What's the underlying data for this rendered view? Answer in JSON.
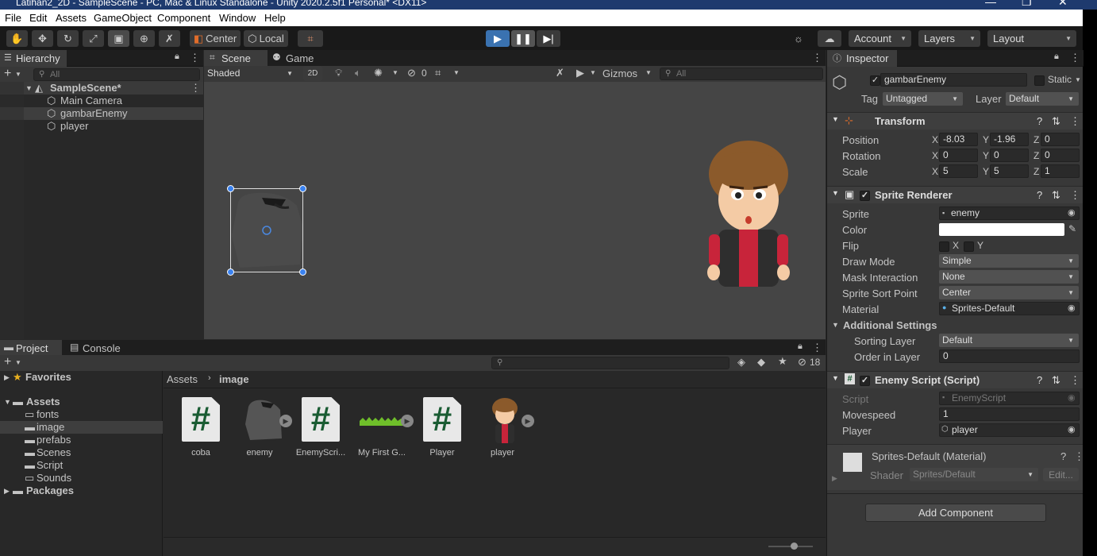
{
  "window": {
    "title": "Latihan2_2D - SampleScene - PC, Mac & Linux Standalone - Unity 2020.2.5f1 Personal* <DX11>"
  },
  "menu": [
    "File",
    "Edit",
    "Assets",
    "GameObject",
    "Component",
    "Window",
    "Help"
  ],
  "toolbar": {
    "pivot": "Center",
    "space": "Local",
    "account": "Account",
    "layers": "Layers",
    "layout": "Layout"
  },
  "hierarchy": {
    "tab": "Hierarchy",
    "search_placeholder": "All",
    "scene": "SampleScene*",
    "objects": [
      "Main Camera",
      "gambarEnemy",
      "player"
    ]
  },
  "scene_view": {
    "tabs": [
      "Scene",
      "Game"
    ],
    "shading": "Shaded",
    "mode2d": "2D",
    "hidden_count": "0",
    "gizmos": "Gizmos",
    "search_placeholder": "All"
  },
  "project": {
    "tabs": [
      "Project",
      "Console"
    ],
    "hidden_count": "18",
    "tree": {
      "favorites": "Favorites",
      "assets": "Assets",
      "folders": [
        "fonts",
        "image",
        "prefabs",
        "Scenes",
        "Script",
        "Sounds"
      ],
      "packages": "Packages"
    },
    "breadcrumb": [
      "Assets",
      "image"
    ],
    "assets": [
      {
        "name": "coba",
        "kind": "script"
      },
      {
        "name": "enemy",
        "kind": "sprite"
      },
      {
        "name": "EnemyScri...",
        "kind": "script"
      },
      {
        "name": "My First G...",
        "kind": "grass"
      },
      {
        "name": "Player",
        "kind": "script"
      },
      {
        "name": "player",
        "kind": "character"
      }
    ]
  },
  "inspector": {
    "tab": "Inspector",
    "object_name": "gambarEnemy",
    "static_label": "Static",
    "tag_label": "Tag",
    "tag_value": "Untagged",
    "layer_label": "Layer",
    "layer_value": "Default",
    "transform": {
      "title": "Transform",
      "position_label": "Position",
      "rotation_label": "Rotation",
      "scale_label": "Scale",
      "position": {
        "x": "-8.03",
        "y": "-1.96",
        "z": "0"
      },
      "rotation": {
        "x": "0",
        "y": "0",
        "z": "0"
      },
      "scale": {
        "x": "5",
        "y": "5",
        "z": "1"
      }
    },
    "sprite_renderer": {
      "title": "Sprite Renderer",
      "sprite_label": "Sprite",
      "sprite": "enemy",
      "color_label": "Color",
      "color": "#ffffff",
      "flip_label": "Flip",
      "flip_x": "X",
      "flip_y": "Y",
      "draw_mode_label": "Draw Mode",
      "draw_mode": "Simple",
      "mask_label": "Mask Interaction",
      "mask": "None",
      "sort_point_label": "Sprite Sort Point",
      "sort_point": "Center",
      "material_label": "Material",
      "material": "Sprites-Default",
      "additional": "Additional Settings",
      "sorting_layer_label": "Sorting Layer",
      "sorting_layer": "Default",
      "order_label": "Order in Layer",
      "order": "0"
    },
    "enemy_script": {
      "title": "Enemy Script (Script)",
      "script_label": "Script",
      "script": "EnemyScript",
      "movespeed_label": "Movespeed",
      "movespeed": "1",
      "player_label": "Player",
      "player": "player"
    },
    "material": {
      "title": "Sprites-Default (Material)",
      "shader_label": "Shader",
      "shader": "Sprites/Default",
      "edit": "Edit..."
    },
    "add_component": "Add Component"
  },
  "colors": {
    "accent": "#3a72b0",
    "play_active": "#4a6fa5"
  }
}
